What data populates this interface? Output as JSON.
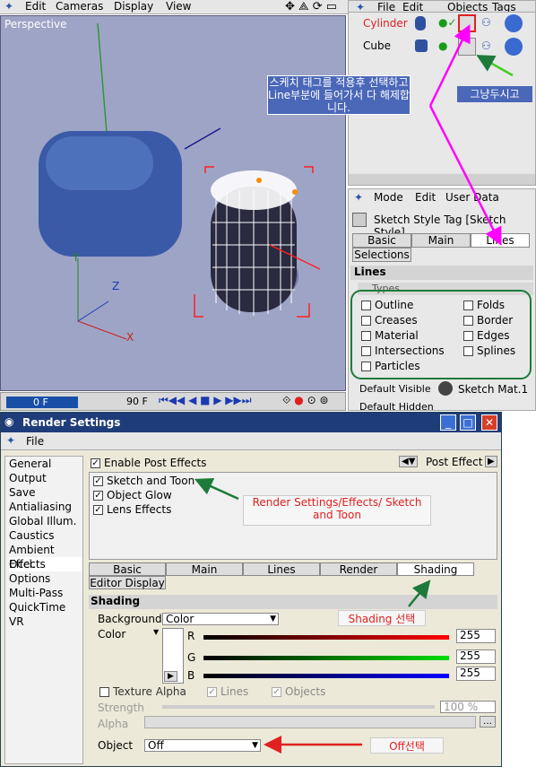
{
  "top_menu": {
    "edit": "Edit",
    "cameras": "Cameras",
    "display": "Display",
    "view": "View",
    "file": "File",
    "objects": "Objects",
    "tags": "Tags"
  },
  "viewport": {
    "label": "Perspective",
    "axis_y": "Y",
    "axis_z": "Z",
    "axis_x": "X"
  },
  "timeline": {
    "frame": "0 F",
    "end": "90 F"
  },
  "object_manager": {
    "objects": [
      {
        "name": "Cylinder",
        "selected": true
      },
      {
        "name": "Cube",
        "selected": false
      }
    ]
  },
  "attr_manager": {
    "menu": [
      "Mode",
      "Edit",
      "User Data"
    ],
    "tag_title": "Sketch Style Tag [Sketch Style]",
    "tabs": [
      "Basic",
      "Main",
      "Lines"
    ],
    "active_tab": "Lines",
    "tab_selections": "Selections",
    "section": "Lines",
    "group": "Types",
    "types_left": [
      "Outline",
      "Creases",
      "Material",
      "Intersections",
      "Particles"
    ],
    "types_right": [
      "Folds",
      "Border",
      "Edges",
      "Splines"
    ],
    "default_visible_label": "Default Visible",
    "default_visible_value": "Sketch Mat.1",
    "default_hidden_label": "Default Hidden"
  },
  "annotations": {
    "korean_note": "스케치 태그를 적용후 선택하고 Line부분에 들어가서 다 해제합니다.",
    "keep": "그냥두시고",
    "effects_note": "Render Settings/Effects/ Sketch and Toon",
    "shading_note": "Shading 선택",
    "off_note": "Off선택"
  },
  "render_settings": {
    "title": "Render Settings",
    "menu_file": "File",
    "sidebar": [
      "General",
      "Output",
      "Save",
      "Antialiasing",
      "Global Illum.",
      "Caustics",
      "Ambient Occl.",
      "Effects",
      "Options",
      "Multi-Pass",
      "QuickTime VR"
    ],
    "active_item": "Effects",
    "enable_post": "Enable Post Effects",
    "post_effect_btn": "Post Effect",
    "effects": [
      "Sketch and Toon",
      "Object Glow",
      "Lens Effects"
    ],
    "tabs": [
      "Basic",
      "Main",
      "Lines",
      "Render",
      "Shading"
    ],
    "active_tab": "Shading",
    "tab_editor": "Editor Display",
    "section": "Shading",
    "background_label": "Background",
    "background_value": "Color",
    "color_label": "Color",
    "r_label": "R",
    "g_label": "G",
    "b_label": "B",
    "r_value": "255",
    "g_value": "255",
    "b_value": "255",
    "texture_alpha": "Texture Alpha",
    "lines_cb": "Lines",
    "objects_cb": "Objects",
    "strength_label": "Strength",
    "strength_value": "100 %",
    "alpha_label": "Alpha",
    "object_label": "Object",
    "object_value": "Off"
  },
  "colors": {
    "accent_red": "#ff0000",
    "green": "#1d7a3a",
    "magenta": "#ff00ff",
    "title_blue": "#1f3c7a"
  }
}
